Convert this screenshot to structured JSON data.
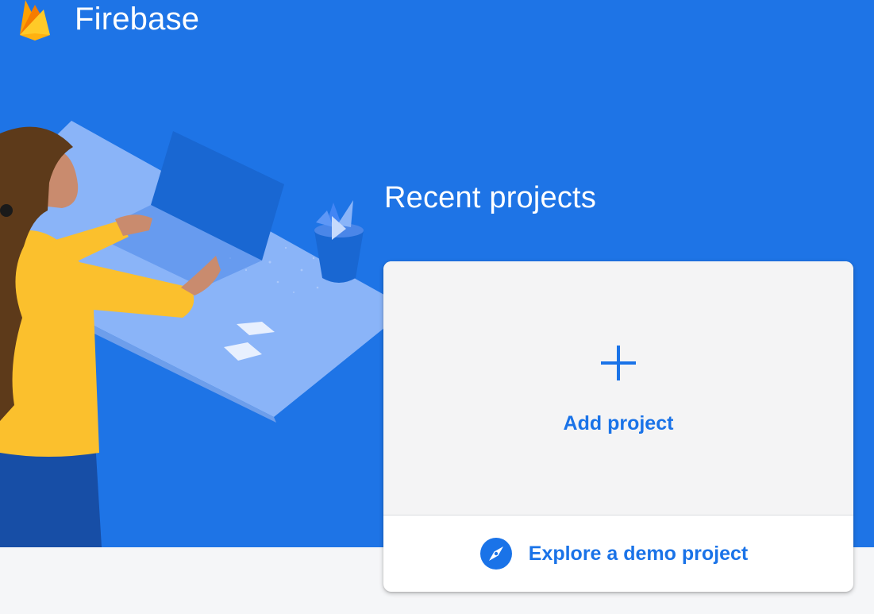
{
  "app": {
    "name": "Firebase"
  },
  "projects": {
    "section_title": "Recent projects",
    "add_project_label": "Add project",
    "add_icon": "plus-icon",
    "explore_demo_label": "Explore a demo project",
    "explore_icon": "compass-icon"
  },
  "colors": {
    "hero_background": "#1e74e6",
    "page_background": "#f5f6f8",
    "accent": "#1a73e8",
    "card_top_background": "#f4f4f5"
  }
}
